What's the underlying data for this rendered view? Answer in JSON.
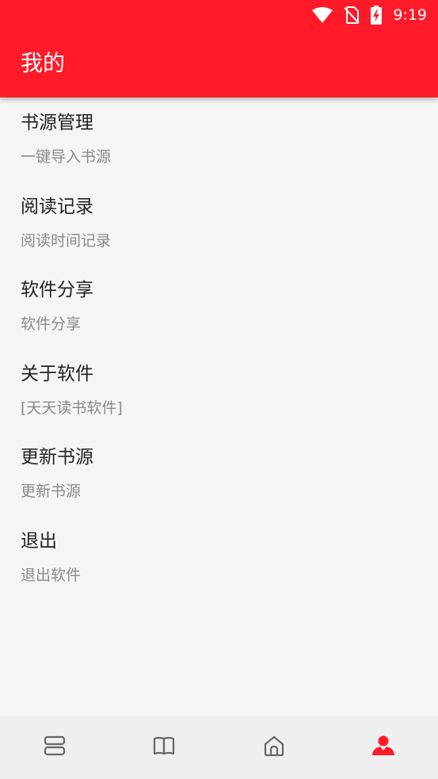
{
  "status_bar": {
    "time": "9:19",
    "icons": [
      "wifi-icon",
      "no-sim-icon",
      "battery-charging-icon"
    ]
  },
  "header": {
    "title": "我的",
    "background_color": "#fe1a28"
  },
  "menu": {
    "items": [
      {
        "title": "书源管理",
        "subtitle": "一键导入书源"
      },
      {
        "title": "阅读记录",
        "subtitle": "阅读时间记录"
      },
      {
        "title": "软件分享",
        "subtitle": "软件分享"
      },
      {
        "title": "关于软件",
        "subtitle": "[天天读书软件]"
      },
      {
        "title": "更新书源",
        "subtitle": "更新书源"
      },
      {
        "title": "退出",
        "subtitle": "退出软件"
      }
    ]
  },
  "bottom_nav": {
    "tabs": [
      {
        "icon": "bookshelf-icon",
        "active": false
      },
      {
        "icon": "book-icon",
        "active": false
      },
      {
        "icon": "home-icon",
        "active": false
      },
      {
        "icon": "profile-icon",
        "active": true
      }
    ],
    "active_color": "#fe1a28",
    "inactive_color": "#666666"
  }
}
